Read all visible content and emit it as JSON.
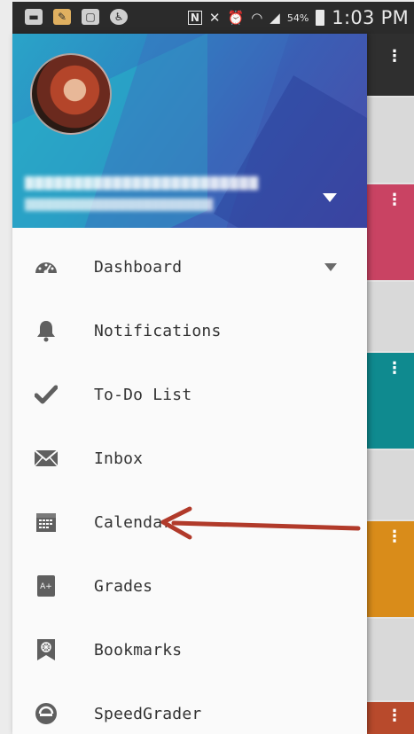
{
  "status_bar": {
    "time": "1:03 PM",
    "battery": "54%",
    "nfc_glyph": "N"
  },
  "drawer": {
    "menu_items": [
      {
        "label": "Dashboard",
        "icon": "speedometer-icon",
        "has_dropdown": true
      },
      {
        "label": "Notifications",
        "icon": "bell-icon"
      },
      {
        "label": "To-Do List",
        "icon": "checkmark-icon"
      },
      {
        "label": "Inbox",
        "icon": "envelope-icon"
      },
      {
        "label": "Calendar",
        "icon": "calendar-icon"
      },
      {
        "label": "Grades",
        "icon": "grades-a-plus-icon"
      },
      {
        "label": "Bookmarks",
        "icon": "bookmark-icon"
      },
      {
        "label": "SpeedGrader",
        "icon": "speedgrader-icon"
      }
    ]
  },
  "background_cards": [
    {
      "color": "#2f2f2f"
    },
    {
      "color": "#d9d9d9"
    },
    {
      "color": "#c94363"
    },
    {
      "color": "#d9d9d9"
    },
    {
      "color": "#0f8a8f"
    },
    {
      "color": "#d9d9d9"
    },
    {
      "color": "#d98c1a"
    },
    {
      "color": "#d9d9d9"
    },
    {
      "color": "#b84a2c"
    }
  ],
  "colors": {
    "annotation_arrow": "#b13a2a",
    "header_gradient_start": "#2aa4c8",
    "header_gradient_end": "#4a4aa8"
  }
}
